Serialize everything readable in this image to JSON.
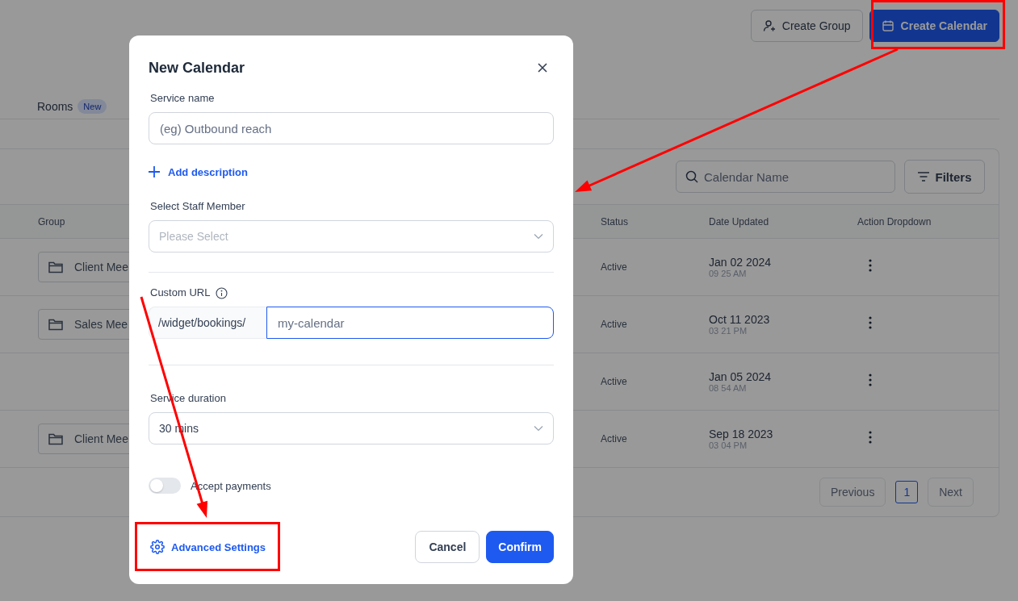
{
  "header": {
    "buttons": [
      {
        "label": "Create Group",
        "kind": "secondary"
      },
      {
        "label": "Create Calendar",
        "kind": "primary"
      }
    ]
  },
  "tabs": [
    {
      "label": "Rooms",
      "badge": "New",
      "selected": false
    }
  ],
  "toolbar": {
    "search": {
      "placeholder": "Calendar Name"
    },
    "filters_button": "Filters"
  },
  "table": {
    "columns": [
      "Group",
      "Status",
      "Date Updated",
      "Action Dropdown"
    ],
    "rows": [
      {
        "group": "Client Mee",
        "status": "Active",
        "date": "Jan 02 2024",
        "time": "09 25 AM"
      },
      {
        "group": "Sales Mee",
        "status": "Active",
        "date": "Oct 11 2023",
        "time": "03 21 PM"
      },
      {
        "status": "Active",
        "date": "Jan 05 2024",
        "time": "08 54 AM"
      },
      {
        "group": "Client Mee",
        "status": "Active",
        "date": "Sep 18 2023",
        "time": "03 04 PM"
      }
    ]
  },
  "pagination": {
    "previous": "Previous",
    "pages": [
      {
        "label": "1",
        "selected": true
      }
    ],
    "next": "Next"
  },
  "modal": {
    "title": "New Calendar",
    "service_name": {
      "label": "Service name",
      "placeholder": "(eg) Outbound reach"
    },
    "add_description": "Add description",
    "staff": {
      "label": "Select Staff Member",
      "placeholder": "Please Select"
    },
    "custom_url": {
      "label": "Custom URL",
      "prefix": "/widget/bookings/",
      "placeholder": "my-calendar"
    },
    "duration": {
      "label": "Service duration",
      "value": "30 mins"
    },
    "accept_payments": {
      "label": "Accept payments",
      "on": false
    },
    "advanced_settings": "Advanced Settings",
    "cancel": "Cancel",
    "confirm": "Confirm"
  }
}
